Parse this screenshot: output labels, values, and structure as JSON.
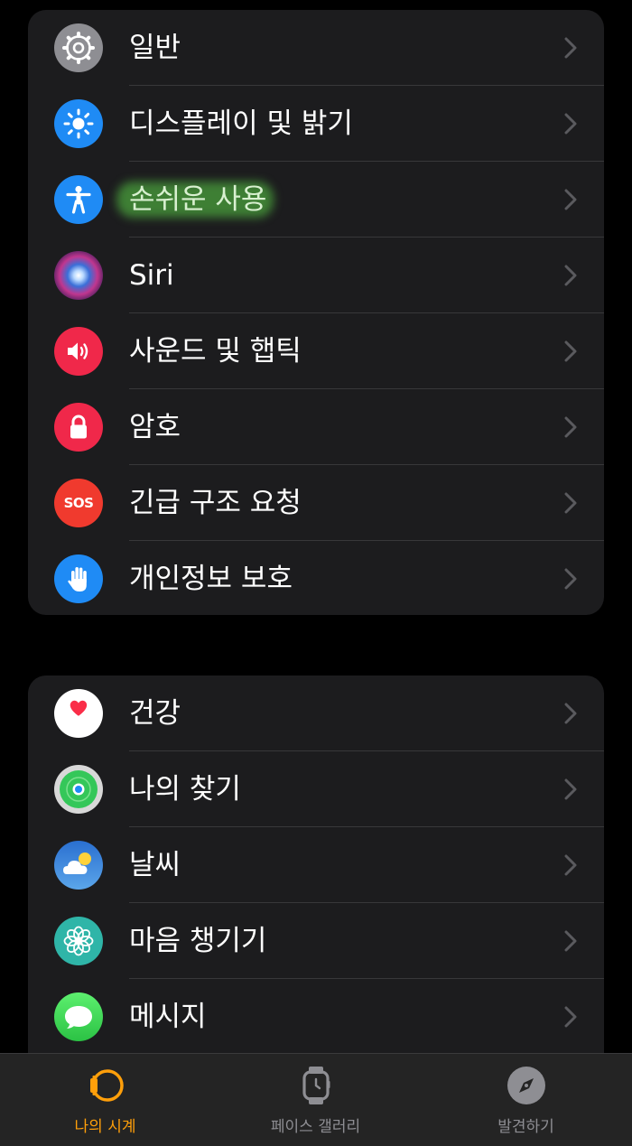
{
  "group1": {
    "items": [
      {
        "label": "일반",
        "icon": "gear-icon",
        "color": "#8e8e93"
      },
      {
        "label": "디스플레이 및 밝기",
        "icon": "sun-icon",
        "color": "#1f8bf5"
      },
      {
        "label": "손쉬운 사용",
        "icon": "accessibility-icon",
        "color": "#1f8bf5"
      },
      {
        "label": "Siri",
        "icon": "siri-icon",
        "color": "#6a2c8a"
      },
      {
        "label": "사운드 및 햅틱",
        "icon": "speaker-icon",
        "color": "#f0284a"
      },
      {
        "label": "암호",
        "icon": "lock-icon",
        "color": "#f0284a"
      },
      {
        "label": "긴급 구조 요청",
        "icon": "sos-icon",
        "icon_text": "SOS",
        "color": "#f03a2e"
      },
      {
        "label": "개인정보 보호",
        "icon": "hand-icon",
        "color": "#1f8bf5"
      }
    ]
  },
  "group2": {
    "items": [
      {
        "label": "건강",
        "icon": "heart-icon",
        "color": "#ffffff"
      },
      {
        "label": "나의 찾기",
        "icon": "find-my-icon",
        "color": "#34c759"
      },
      {
        "label": "날씨",
        "icon": "weather-icon",
        "color": "#2a7fd8"
      },
      {
        "label": "마음 챙기기",
        "icon": "mindfulness-icon",
        "color": "#2fb5a8"
      },
      {
        "label": "메시지",
        "icon": "message-icon",
        "color": "#34c759"
      }
    ]
  },
  "tabbar": {
    "tabs": [
      {
        "label": "나의 시계",
        "icon": "my-watch-icon",
        "active": true
      },
      {
        "label": "페이스 갤러리",
        "icon": "watch-face-icon",
        "active": false
      },
      {
        "label": "발견하기",
        "icon": "compass-icon",
        "active": false
      }
    ],
    "active_color": "#ff9f0a",
    "inactive_color": "#8e8e93"
  }
}
